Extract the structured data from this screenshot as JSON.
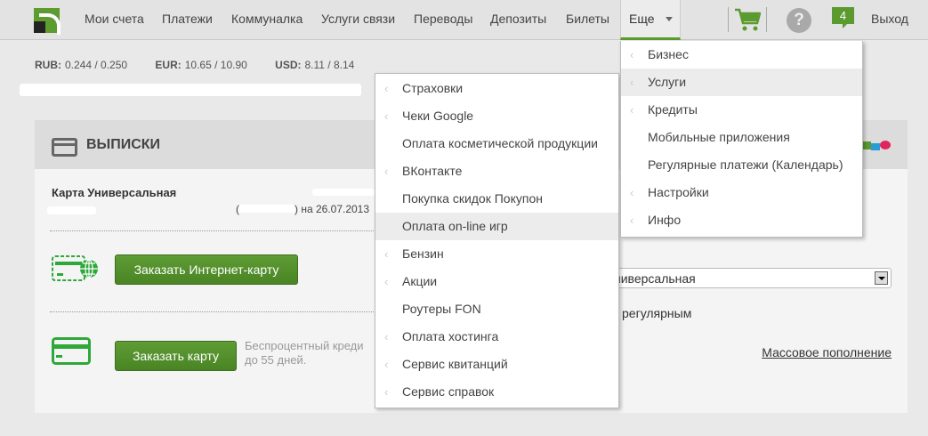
{
  "nav": {
    "items": [
      "Мои счета",
      "Платежи",
      "Коммуналка",
      "Услуги связи",
      "Переводы",
      "Депозиты",
      "Билеты"
    ],
    "more": "Еще",
    "badge": "4",
    "help": "?",
    "logout": "Выход"
  },
  "rates": [
    {
      "cur": "RUB:",
      "val": "0.244 / 0.250"
    },
    {
      "cur": "EUR:",
      "val": "10.65 / 10.90"
    },
    {
      "cur": "USD:",
      "val": "8.11 / 8.14"
    }
  ],
  "panel": {
    "title": "ВЫПИСКИ",
    "card_name": "Карта Универсальная",
    "date_prefix": "(",
    "date_text": ") на 26.07.2013",
    "btn_internet": "Заказать Интернет-карту",
    "btn_card": "Заказать карту",
    "note": "Беспроцентный креди до 55 дней.",
    "select_value": "ниверсальная",
    "regular": "к регулярным",
    "mass": "Массовое пополнение"
  },
  "left_menu": [
    {
      "label": "Страховки",
      "sub": true
    },
    {
      "label": "Чеки Google",
      "sub": true
    },
    {
      "label": "Оплата косметической продукции",
      "sub": false
    },
    {
      "label": "ВКонтакте",
      "sub": true
    },
    {
      "label": "Покупка скидок Покупон",
      "sub": false
    },
    {
      "label": "Оплата on-line игр",
      "sub": false,
      "hl": true
    },
    {
      "label": "Бензин",
      "sub": true
    },
    {
      "label": "Акции",
      "sub": true
    },
    {
      "label": "Роутеры FON",
      "sub": false
    },
    {
      "label": "Оплата хостинга",
      "sub": true
    },
    {
      "label": "Сервис квитанций",
      "sub": true
    },
    {
      "label": "Сервис справок",
      "sub": true
    }
  ],
  "right_menu": [
    {
      "label": "Бизнес",
      "sub": true
    },
    {
      "label": "Услуги",
      "sub": true,
      "hl": true
    },
    {
      "label": "Кредиты",
      "sub": true
    },
    {
      "label": "Мобильные приложения",
      "sub": false
    },
    {
      "label": "Регулярные платежи (Календарь)",
      "sub": false
    },
    {
      "label": "Настройки",
      "sub": true
    },
    {
      "label": "Инфо",
      "sub": true
    }
  ],
  "colors": {
    "accent": "#5a9a2e"
  }
}
